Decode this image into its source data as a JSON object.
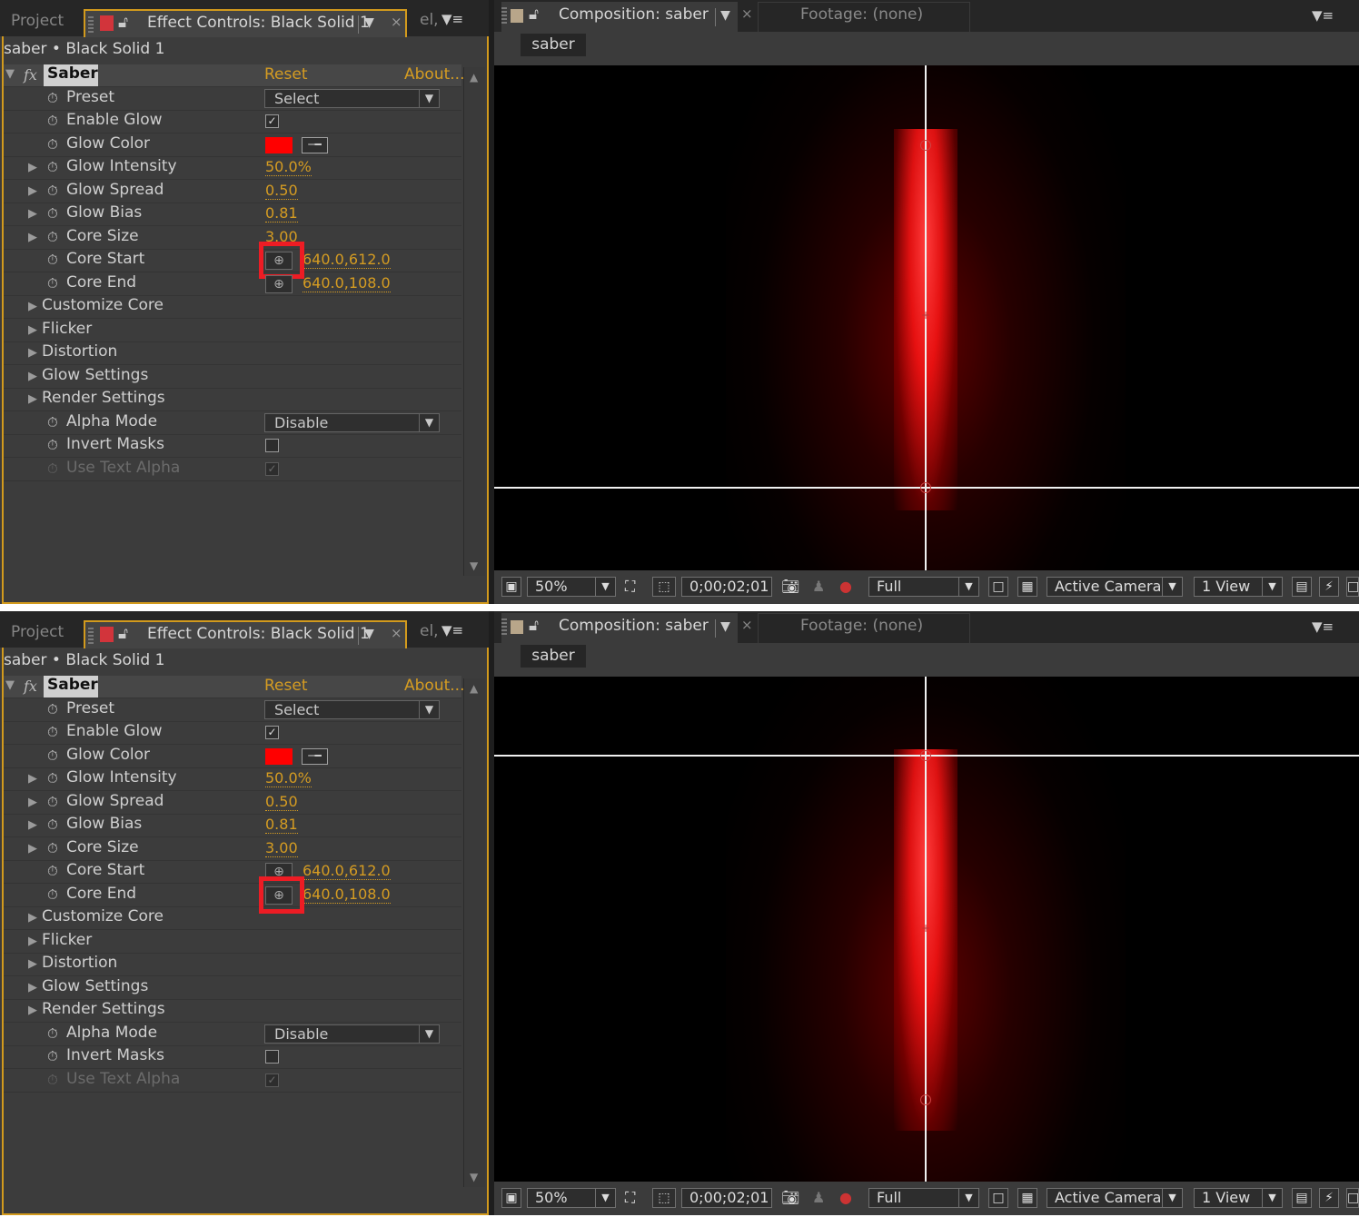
{
  "colors": {
    "accent": "#d59c22",
    "panel_border": "#d29a1d",
    "glow": "#ff0000",
    "highlight": "#ed1c24"
  },
  "icons": {
    "stopwatch": "stopwatch-icon",
    "twirl": "triangle-right-icon",
    "lock": "lock-icon",
    "eyedropper": "eyedropper-icon",
    "crosshair": "crosshair-icon"
  },
  "screens": [
    {
      "left": {
        "tab_project": "Project",
        "tab_effect": "Effect Controls: Black Solid 1",
        "tab_extra": "el,",
        "breadcrumb": "saber • Black Solid 1",
        "effect_name": "Saber",
        "reset": "Reset",
        "about": "About...",
        "rows": [
          {
            "label": "Preset",
            "value": "Select"
          },
          {
            "label": "Enable Glow",
            "checked": true
          },
          {
            "label": "Glow Color",
            "color": "#ff0000"
          },
          {
            "label": "Glow Intensity",
            "value": "50.0%"
          },
          {
            "label": "Glow Spread",
            "value": "0.50"
          },
          {
            "label": "Glow Bias",
            "value": "0.81"
          },
          {
            "label": "Core Size",
            "value": "3.00"
          },
          {
            "label": "Core Start",
            "value": "640.0,612.0",
            "highlighted": true
          },
          {
            "label": "Core End",
            "value": "640.0,108.0",
            "highlighted": false
          },
          {
            "label": "Customize Core"
          },
          {
            "label": "Flicker"
          },
          {
            "label": "Distortion"
          },
          {
            "label": "Glow Settings"
          },
          {
            "label": "Render Settings"
          },
          {
            "label": "Alpha Mode",
            "value": "Disable"
          },
          {
            "label": "Invert Masks",
            "checked": false
          },
          {
            "label": "Use Text Alpha",
            "checked": true,
            "disabled": true
          }
        ]
      },
      "right": {
        "comp_tab": "Composition: saber",
        "footage_tab": "Footage: (none)",
        "comp_button": "saber",
        "zoom": "50%",
        "timecode": "0;00;02;01",
        "resolution": "Full",
        "camera": "Active Camera",
        "views": "1 View"
      }
    },
    {
      "left": {
        "tab_project": "Project",
        "tab_effect": "Effect Controls: Black Solid 1",
        "tab_extra": "el,",
        "breadcrumb": "saber • Black Solid 1",
        "effect_name": "Saber",
        "reset": "Reset",
        "about": "About...",
        "rows": [
          {
            "label": "Preset",
            "value": "Select"
          },
          {
            "label": "Enable Glow",
            "checked": true
          },
          {
            "label": "Glow Color",
            "color": "#ff0000"
          },
          {
            "label": "Glow Intensity",
            "value": "50.0%"
          },
          {
            "label": "Glow Spread",
            "value": "0.50"
          },
          {
            "label": "Glow Bias",
            "value": "0.81"
          },
          {
            "label": "Core Size",
            "value": "3.00"
          },
          {
            "label": "Core Start",
            "value": "640.0,612.0",
            "highlighted": false
          },
          {
            "label": "Core End",
            "value": "640.0,108.0",
            "highlighted": true
          },
          {
            "label": "Customize Core"
          },
          {
            "label": "Flicker"
          },
          {
            "label": "Distortion"
          },
          {
            "label": "Glow Settings"
          },
          {
            "label": "Render Settings"
          },
          {
            "label": "Alpha Mode",
            "value": "Disable"
          },
          {
            "label": "Invert Masks",
            "checked": false
          },
          {
            "label": "Use Text Alpha",
            "checked": true,
            "disabled": true
          }
        ]
      },
      "right": {
        "comp_tab": "Composition: saber",
        "footage_tab": "Footage: (none)",
        "comp_button": "saber",
        "zoom": "50%",
        "timecode": "0;00;02;01",
        "resolution": "Full",
        "camera": "Active Camera",
        "views": "1 View"
      }
    }
  ]
}
